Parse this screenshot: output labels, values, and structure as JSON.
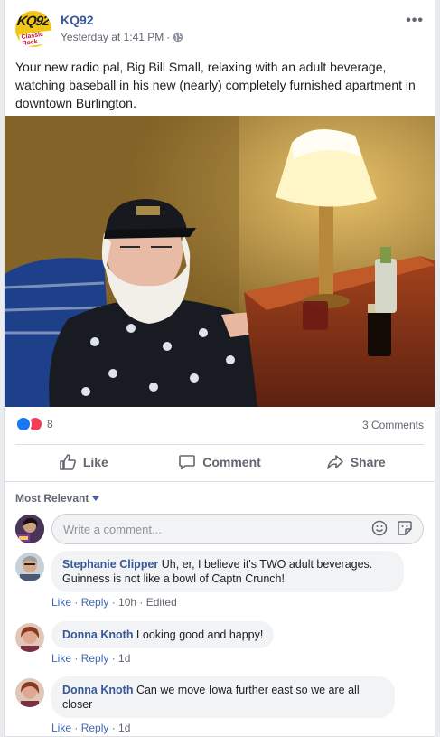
{
  "post": {
    "page_name": "KQ92",
    "logo_text": "KQ92",
    "logo_subtext": "Classic Rock",
    "timestamp": "Yesterday at 1:41 PM",
    "separator": "·",
    "body": "Your new radio pal, Big Bill Small, relaxing with an adult beverage, watching baseball in his new (nearly) completely furnished apartment in downtown Burlington.",
    "reaction_count": "8",
    "comment_count": "3 Comments"
  },
  "actions": {
    "like": "Like",
    "comment": "Comment",
    "share": "Share"
  },
  "comments_section": {
    "sort_label": "Most Relevant",
    "composer_placeholder": "Write a comment..."
  },
  "comments": [
    {
      "author": "Stephanie Clipper",
      "text": "Uh, er, I believe it's TWO adult beverages. Guinness is not like a bowl of Captn Crunch!",
      "like": "Like",
      "reply": "Reply",
      "time": "10h",
      "edited": "Edited"
    },
    {
      "author": "Donna Knoth",
      "text": "Looking good and happy!",
      "like": "Like",
      "reply": "Reply",
      "time": "1d"
    },
    {
      "author": "Donna Knoth",
      "text": "Can we move Iowa further east so we are all closer",
      "like": "Like",
      "reply": "Reply",
      "time": "1d"
    }
  ],
  "colors": {
    "link_blue": "#385898",
    "like_blue": "#1877f2",
    "love_red": "#f33e58",
    "muted": "#606770"
  },
  "icons": [
    "globe-icon",
    "more-options-icon",
    "like-reaction-icon",
    "love-reaction-icon",
    "thumbs-up-icon",
    "comment-icon",
    "share-icon",
    "caret-down-icon",
    "emoji-icon",
    "sticker-icon"
  ]
}
